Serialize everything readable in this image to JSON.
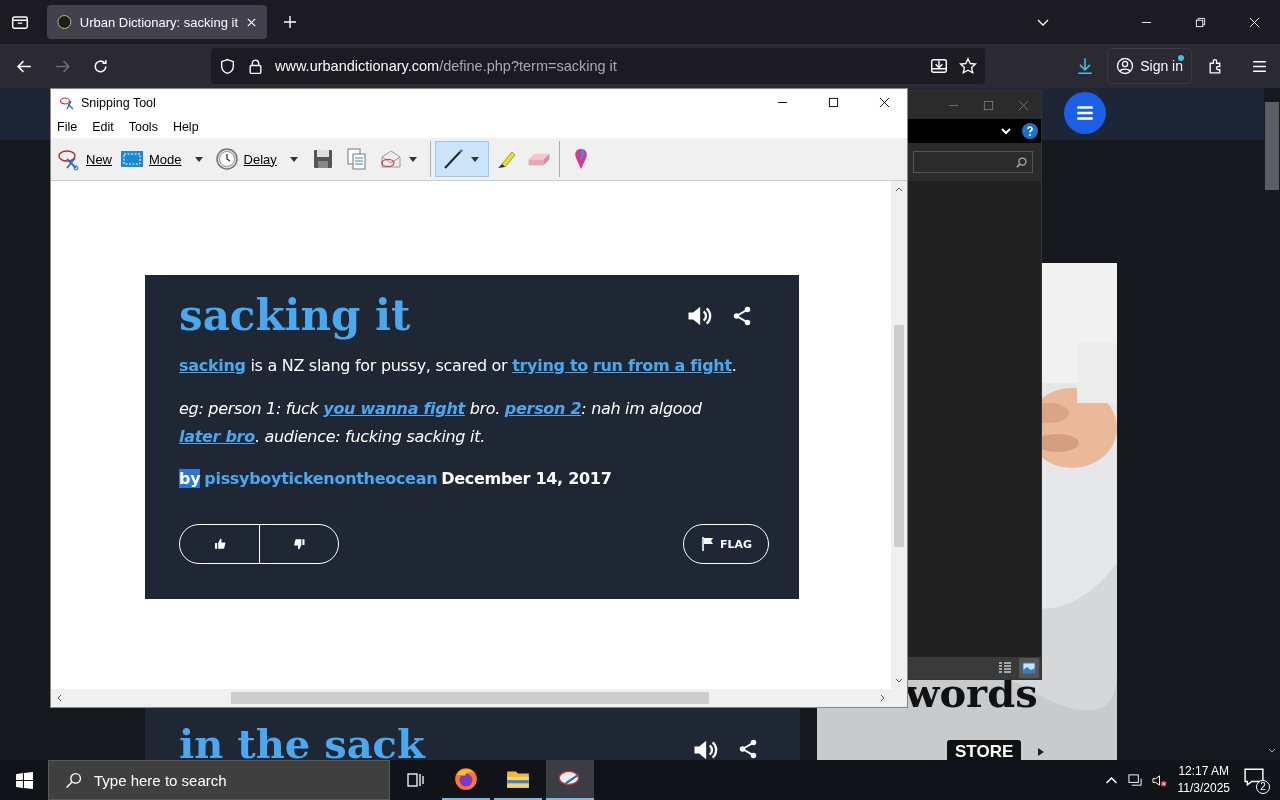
{
  "browser": {
    "tabs": [
      {
        "title": "Urban Dictionary: sacking it",
        "selected": true
      }
    ],
    "url": {
      "host": "www.urbandictionary.com",
      "path": "/define.php?term=sacking it"
    },
    "forward_disabled": true,
    "sign_in": "Sign in"
  },
  "snipping_tool": {
    "title": "Snipping Tool",
    "menu": [
      "File",
      "Edit",
      "Tools",
      "Help"
    ],
    "labeled_tools": [
      {
        "kind": "new",
        "label": "New",
        "dropdown": false
      },
      {
        "kind": "mode",
        "label": "Mode",
        "dropdown": true
      },
      {
        "kind": "delay",
        "label": "Delay",
        "dropdown": true
      }
    ],
    "icon_tools": [
      {
        "kind": "save",
        "dropdown": false,
        "selected": false
      },
      {
        "kind": "copy",
        "dropdown": false,
        "selected": false
      },
      {
        "kind": "send",
        "dropdown": true,
        "selected": false
      },
      {
        "kind": "pen",
        "dropdown": true,
        "selected": true
      },
      {
        "kind": "highlighter",
        "dropdown": false,
        "selected": false
      },
      {
        "kind": "eraser",
        "dropdown": false,
        "selected": false
      },
      {
        "kind": "paint",
        "dropdown": false,
        "selected": false
      }
    ],
    "capture": {
      "word": "sacking it",
      "definition": [
        {
          "text": "sacking",
          "kind": "link"
        },
        {
          "text": " is a NZ slang for pussy, scared or ",
          "kind": "text"
        },
        {
          "text": "trying to",
          "kind": "link"
        },
        {
          "text": "run from a fight",
          "kind": "link"
        },
        {
          "text": ".",
          "kind": "text"
        }
      ],
      "example": [
        {
          "text": "eg: person 1: fuck ",
          "kind": "text"
        },
        {
          "text": "you wanna fight",
          "kind": "link"
        },
        {
          "text": " bro. ",
          "kind": "text"
        },
        {
          "text": "person 2",
          "kind": "link"
        },
        {
          "text": ": nah im algood ",
          "kind": "text"
        },
        {
          "text": "later bro",
          "kind": "link"
        },
        {
          "text": ". audience: fucking sacking it.",
          "kind": "text"
        }
      ],
      "by": "by",
      "by_selected": true,
      "author": "pissyboytickenontheocean",
      "date": "December 14, 2017",
      "flag": "FLAG"
    }
  },
  "page": {
    "next_word": "in the sack",
    "ad": {
      "headline": "words",
      "store": "STORE"
    }
  },
  "taskbar": {
    "search_placeholder": "Type here to search",
    "apps": [
      {
        "kind": "firefox",
        "selected": false
      },
      {
        "kind": "explorer",
        "selected": false
      },
      {
        "kind": "snip",
        "selected": true
      }
    ],
    "time": "12:17 AM",
    "date": "11/3/2025",
    "notifications": "2"
  }
}
